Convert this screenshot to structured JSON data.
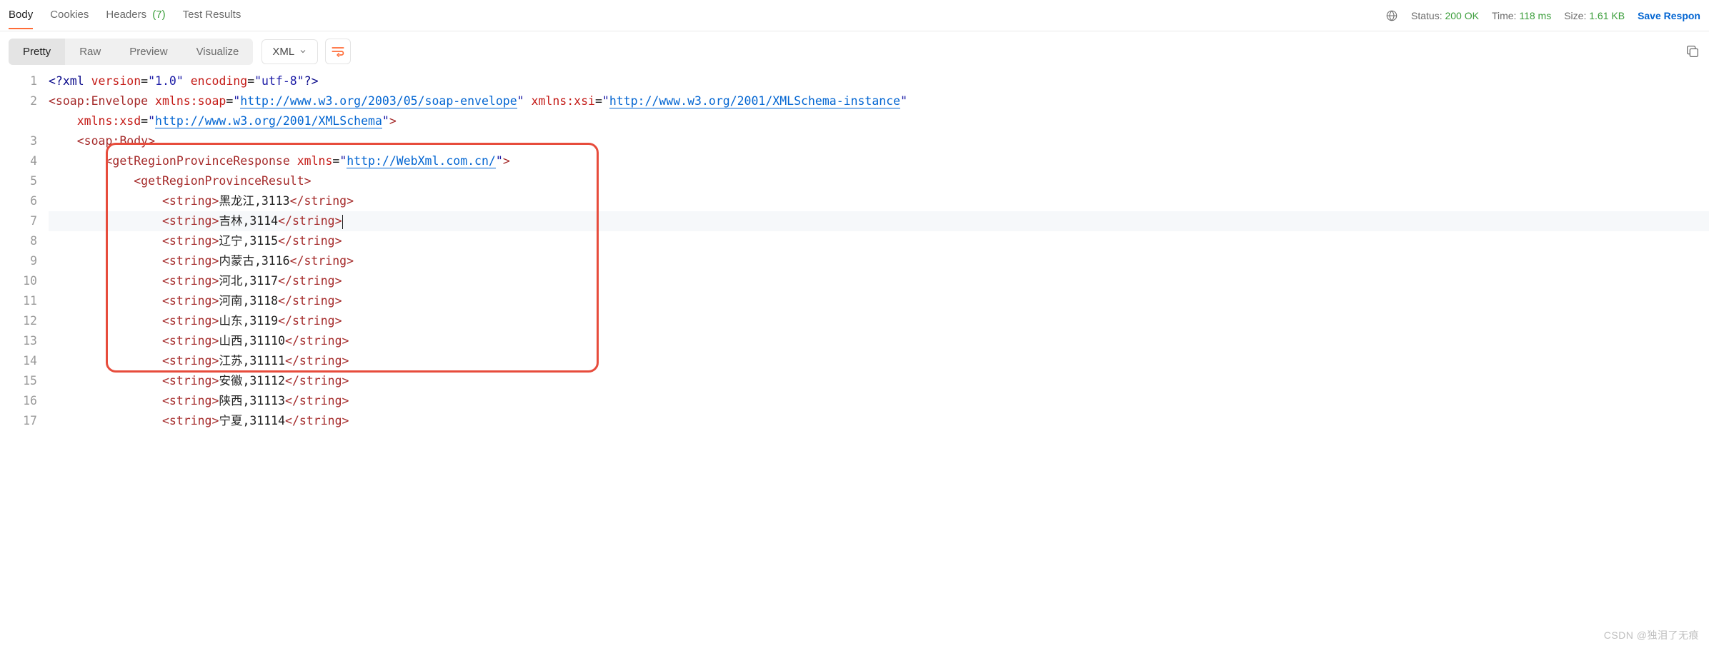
{
  "tabs": {
    "body": "Body",
    "cookies": "Cookies",
    "headers": "Headers",
    "headers_count": "(7)",
    "test_results": "Test Results"
  },
  "status_bar": {
    "status_label": "Status:",
    "status_value": "200 OK",
    "time_label": "Time:",
    "time_value": "118 ms",
    "size_label": "Size:",
    "size_value": "1.61 KB",
    "save_response": "Save Respon"
  },
  "view_tabs": {
    "pretty": "Pretty",
    "raw": "Raw",
    "preview": "Preview",
    "visualize": "Visualize"
  },
  "format_select": "XML",
  "xml": {
    "xml_decl_open": "<?xml",
    "version_attr": "version",
    "version_val": "\"1.0\"",
    "encoding_attr": "encoding",
    "encoding_val": "\"utf-8\"",
    "xml_decl_close": "?>",
    "envelope_open": "<soap:Envelope",
    "xmlns_soap_attr": "xmlns:soap",
    "xmlns_soap_val": "http://www.w3.org/2003/05/soap-envelope",
    "xmlns_xsi_attr": "xmlns:xsi",
    "xmlns_xsi_val": "http://www.w3.org/2001/XMLSchema-instance",
    "xmlns_xsd_attr": "xmlns:xsd",
    "xmlns_xsd_val": "http://www.w3.org/2001/XMLSchema",
    "body_open": "<soap:Body>",
    "resp_open": "<getRegionProvinceResponse",
    "resp_xmlns_attr": "xmlns",
    "resp_xmlns_val": "http://WebXml.com.cn/",
    "result_open": "<getRegionProvinceResult>",
    "string_open": "<string>",
    "string_close": "</string>",
    "items": [
      "黑龙江,3113",
      "吉林,3114",
      "辽宁,3115",
      "内蒙古,3116",
      "河北,3117",
      "河南,3118",
      "山东,3119",
      "山西,31110",
      "江苏,31111",
      "安徽,31112",
      "陕西,31113",
      "宁夏,31114"
    ]
  },
  "line_numbers": [
    "1",
    "2",
    "",
    "3",
    "4",
    "5",
    "6",
    "7",
    "8",
    "9",
    "10",
    "11",
    "12",
    "13",
    "14",
    "15",
    "16",
    "17"
  ],
  "watermark": "CSDN @独泪了无痕"
}
